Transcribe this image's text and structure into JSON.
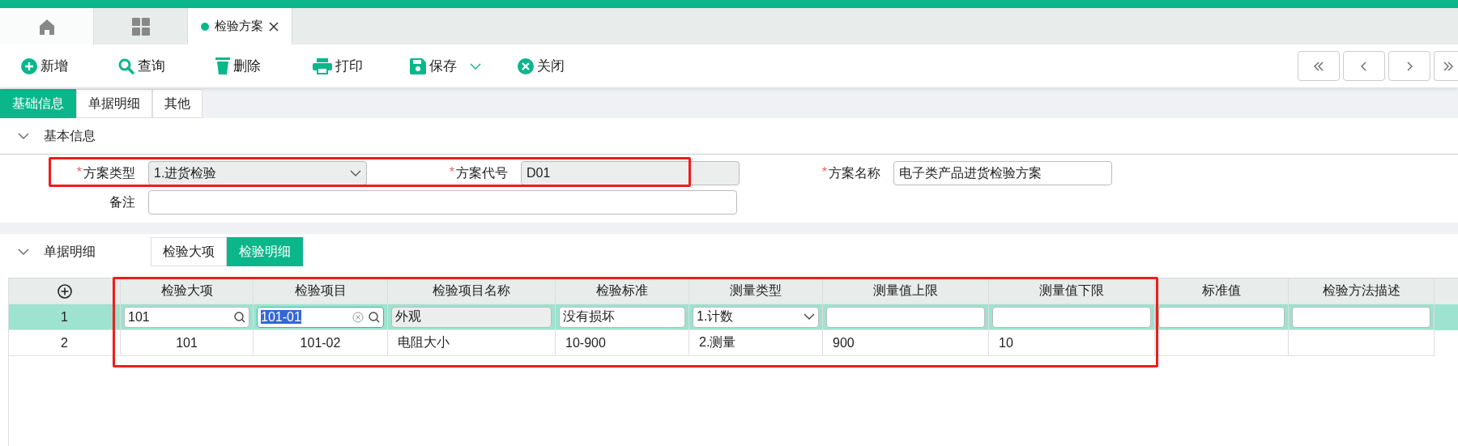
{
  "tabs": [
    {
      "kind": "home",
      "selected": false
    },
    {
      "kind": "apps",
      "selected": false
    },
    {
      "kind": "page",
      "label": "检验方案",
      "selected": true
    }
  ],
  "toolbar": [
    {
      "kind": "add",
      "label": "新增",
      "dropdown": false
    },
    {
      "kind": "search",
      "label": "查询",
      "dropdown": false
    },
    {
      "kind": "delete",
      "label": "删除",
      "dropdown": false
    },
    {
      "kind": "print",
      "label": "打印",
      "dropdown": false
    },
    {
      "kind": "save",
      "label": "保存",
      "dropdown": true
    },
    {
      "kind": "close",
      "label": "关闭",
      "dropdown": false
    }
  ],
  "pager": [
    {
      "kind": "first"
    },
    {
      "kind": "prev"
    },
    {
      "kind": "next"
    },
    {
      "kind": "last"
    }
  ],
  "form_tabs": [
    {
      "label": "基础信息",
      "selected": true
    },
    {
      "label": "单据明细",
      "selected": false
    },
    {
      "label": "其他",
      "selected": false
    }
  ],
  "basic_section": {
    "title": "基本信息",
    "expanded": true,
    "fields": [
      {
        "kind": "select",
        "label": "方案类型",
        "required_mark": "*",
        "value": "1.进货检验",
        "readonly": false,
        "highlighted": true
      },
      {
        "kind": "text",
        "label": "方案代号",
        "required_mark": "*",
        "value": "D01",
        "readonly": true,
        "highlighted": true
      },
      {
        "kind": "text",
        "label": "方案名称",
        "required_mark": "*",
        "value": "电子类产品进货检验方案",
        "readonly": false,
        "highlighted": false
      },
      {
        "kind": "wide",
        "label": "备注",
        "readonly": false,
        "highlighted": false
      }
    ]
  },
  "detail_section": {
    "title": "单据明细",
    "expanded": true,
    "tabs": [
      {
        "label": "检验大项",
        "selected": false
      },
      {
        "label": "检验明细",
        "selected": true
      }
    ],
    "table": {
      "columns": [
        {
          "label": "检验大项",
          "highlighted": true
        },
        {
          "label": "检验项目",
          "highlighted": true
        },
        {
          "label": "检验项目名称",
          "highlighted": true
        },
        {
          "label": "检验标准",
          "highlighted": true
        },
        {
          "label": "测量类型",
          "highlighted": true
        },
        {
          "label": "测量值上限",
          "highlighted": true
        },
        {
          "label": "测量值下限",
          "highlighted": true
        },
        {
          "label": "标准值",
          "highlighted": false
        },
        {
          "label": "检验方法描述",
          "highlighted": false
        }
      ],
      "rows": [
        {
          "number": "1",
          "selected": true,
          "cells": [
            {
              "kind": "lookup",
              "value": "101"
            },
            {
              "kind": "lookup_focused",
              "value": "101-01"
            },
            {
              "kind": "readonly",
              "value": "外观"
            },
            {
              "kind": "input",
              "value": "没有损坏"
            },
            {
              "kind": "select",
              "value": "1.计数"
            },
            {
              "kind": "input"
            },
            {
              "kind": "input"
            },
            {
              "kind": "input"
            },
            {
              "kind": "input"
            }
          ]
        },
        {
          "number": "2",
          "selected": false,
          "cells": [
            {
              "kind": "center",
              "value": "101"
            },
            {
              "kind": "center",
              "value": "101-02"
            },
            {
              "kind": "left",
              "value": "电阻大小"
            },
            {
              "kind": "left",
              "value": "10-900"
            },
            {
              "kind": "left",
              "value": "2.测量"
            },
            {
              "kind": "left",
              "value": "900"
            },
            {
              "kind": "left",
              "value": "10"
            },
            {
              "kind": "left"
            },
            {
              "kind": "left"
            }
          ]
        }
      ]
    }
  }
}
